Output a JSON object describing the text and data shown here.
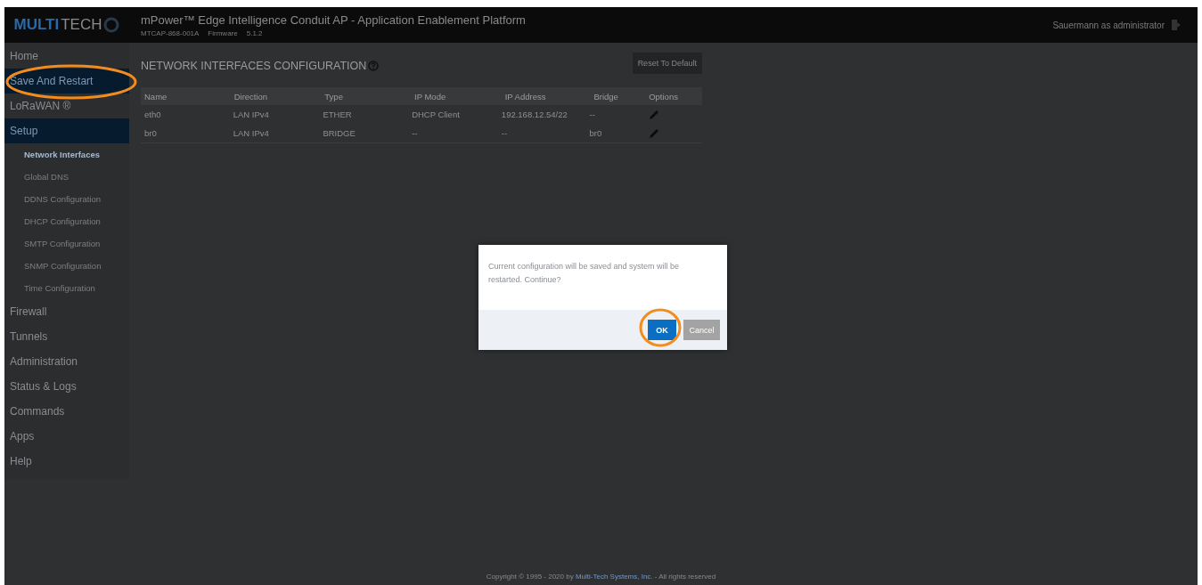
{
  "header": {
    "logo": {
      "bold": "MULTI",
      "rest": "TECH"
    },
    "title": "mPower™ Edge Intelligence Conduit AP - Application Enablement Platform",
    "model": "MTCAP-868-001A",
    "firmware_label": "Firmware",
    "firmware": "5.1.2",
    "user": "Sauermann as administrator"
  },
  "sidebar": {
    "items": [
      {
        "label": "Home",
        "kind": "main",
        "selected": false
      },
      {
        "label": "Save And Restart",
        "kind": "main",
        "selected": true
      },
      {
        "label": "LoRaWAN ®",
        "kind": "main",
        "selected": false
      },
      {
        "label": "Setup",
        "kind": "main",
        "selected": true
      },
      {
        "label": "Network Interfaces",
        "kind": "sub",
        "selected": true
      },
      {
        "label": "Global DNS",
        "kind": "sub",
        "selected": false
      },
      {
        "label": "DDNS Configuration",
        "kind": "sub",
        "selected": false
      },
      {
        "label": "DHCP Configuration",
        "kind": "sub",
        "selected": false
      },
      {
        "label": "SMTP Configuration",
        "kind": "sub",
        "selected": false
      },
      {
        "label": "SNMP Configuration",
        "kind": "sub",
        "selected": false
      },
      {
        "label": "Time Configuration",
        "kind": "sub",
        "selected": false
      },
      {
        "label": "Firewall",
        "kind": "main",
        "selected": false
      },
      {
        "label": "Tunnels",
        "kind": "main",
        "selected": false
      },
      {
        "label": "Administration",
        "kind": "main",
        "selected": false
      },
      {
        "label": "Status & Logs",
        "kind": "main",
        "selected": false
      },
      {
        "label": "Commands",
        "kind": "main",
        "selected": false
      },
      {
        "label": "Apps",
        "kind": "main",
        "selected": false
      },
      {
        "label": "Help",
        "kind": "main",
        "selected": false
      }
    ]
  },
  "page": {
    "title": "NETWORK INTERFACES CONFIGURATION",
    "reset_button": "Reset To Default",
    "table": {
      "columns": [
        "Name",
        "Direction",
        "Type",
        "IP Mode",
        "IP Address",
        "Bridge",
        "Options"
      ],
      "rows": [
        [
          "eth0",
          "LAN IPv4",
          "ETHER",
          "DHCP Client",
          "192.168.12.54/22",
          "--"
        ],
        [
          "br0",
          "LAN IPv4",
          "BRIDGE",
          "--",
          "--",
          "br0"
        ]
      ]
    }
  },
  "dialog": {
    "message": "Current configuration will be saved and system will be restarted. Continue?",
    "buttons": [
      {
        "label": "OK",
        "kind": "primary"
      },
      {
        "label": "Cancel",
        "kind": "secondary"
      }
    ]
  },
  "footer": {
    "prefix": "Copyright © 1995 - 2020 by",
    "link": "Multi-Tech Systems, Inc.",
    "suffix": "- All rights reserved"
  }
}
